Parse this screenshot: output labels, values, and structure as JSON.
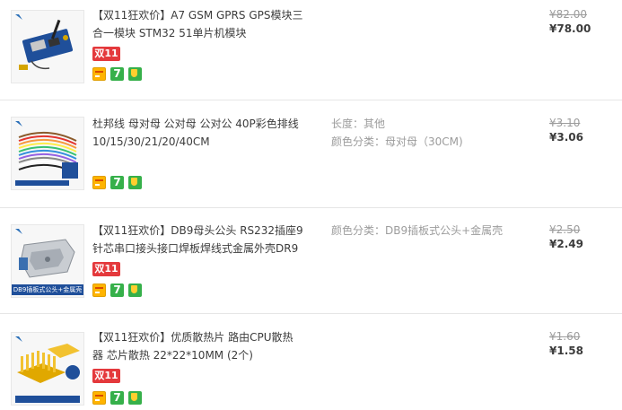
{
  "items": [
    {
      "title": "【双11狂欢价】A7 GSM GPRS GPS模块三合一模块 STM32 51单片机模块",
      "sku": [],
      "original_price": "¥82.00",
      "price": "¥78.00",
      "promo": "双11",
      "badges": [
        "card-icon",
        "seven-day-icon",
        "shield-icon"
      ],
      "thumb_caption": ""
    },
    {
      "title": "杜邦线 母对母 公对母 公对公 40P彩色排线 10/15/30/21/20/40CM",
      "sku": [
        {
          "label": "长度：",
          "value": "其他"
        },
        {
          "label": "颜色分类：",
          "value": "母对母（30CM)"
        }
      ],
      "original_price": "¥3.10",
      "price": "¥3.06",
      "promo": "",
      "badges": [
        "card-icon",
        "seven-day-icon",
        "shield-icon"
      ],
      "thumb_caption": ""
    },
    {
      "title": "【双11狂欢价】DB9母头公头 RS232插座9针芯串口接头接口焊板焊线式金属外壳DR9",
      "sku": [
        {
          "label": "颜色分类：",
          "value": "DB9插板式公头+金属壳"
        }
      ],
      "original_price": "¥2.50",
      "price": "¥2.49",
      "promo": "双11",
      "badges": [
        "card-icon",
        "seven-day-icon",
        "shield-icon"
      ],
      "thumb_caption": "DB9插板式公头+金属壳"
    },
    {
      "title": "【双11狂欢价】优质散热片 路由CPU散热器 芯片散热 22*22*10MM (2个)",
      "sku": [],
      "original_price": "¥1.60",
      "price": "¥1.58",
      "promo": "双11",
      "badges": [
        "card-icon",
        "seven-day-icon",
        "shield-icon"
      ],
      "thumb_caption": ""
    }
  ],
  "badge_text": {
    "seven": "7"
  },
  "colors": {
    "promo": "#e4393c",
    "badge_green": "#36b04a",
    "badge_yellow": "#ffb400"
  }
}
